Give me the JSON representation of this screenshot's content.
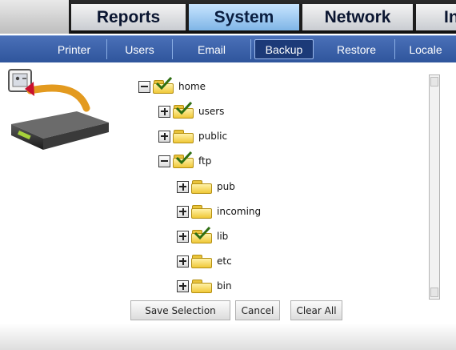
{
  "main_tabs": [
    {
      "label": "Reports",
      "active": false
    },
    {
      "label": "System",
      "active": true
    },
    {
      "label": "Network",
      "active": false
    },
    {
      "label": "In",
      "active": false
    }
  ],
  "sub_tabs": [
    {
      "label": "Printer",
      "active": false
    },
    {
      "label": "Users",
      "active": false
    },
    {
      "label": "Email",
      "active": false
    },
    {
      "label": "Backup",
      "active": true
    },
    {
      "label": "Restore",
      "active": false
    },
    {
      "label": "Locale",
      "active": false
    }
  ],
  "tree": [
    {
      "label": "home",
      "expanded": true,
      "selected": true,
      "level": 0
    },
    {
      "label": "users",
      "expanded": false,
      "selected": true,
      "level": 1
    },
    {
      "label": "public",
      "expanded": false,
      "selected": false,
      "level": 1
    },
    {
      "label": "ftp",
      "expanded": true,
      "selected": true,
      "level": 1
    },
    {
      "label": "pub",
      "expanded": false,
      "selected": false,
      "level": 2
    },
    {
      "label": "incoming",
      "expanded": false,
      "selected": false,
      "level": 2
    },
    {
      "label": "lib",
      "expanded": false,
      "selected": true,
      "level": 2
    },
    {
      "label": "etc",
      "expanded": false,
      "selected": false,
      "level": 2
    },
    {
      "label": "bin",
      "expanded": false,
      "selected": false,
      "level": 2
    }
  ],
  "buttons": {
    "save_selection": "Save Selection",
    "cancel": "Cancel",
    "clear_all": "Clear All"
  },
  "icons": {
    "backup_graphic": "backup-to-server-icon",
    "expand": "plus-box-icon",
    "collapse": "minus-box-icon",
    "folder": "folder-icon",
    "selected_folder": "checked-folder-icon"
  },
  "colors": {
    "active_main_tab": "#8cbfec",
    "sub_bar": "#3d62aa",
    "active_sub_tab": "#1c3a78",
    "folder": "#f0c838",
    "checkmark": "#2e6e12"
  }
}
